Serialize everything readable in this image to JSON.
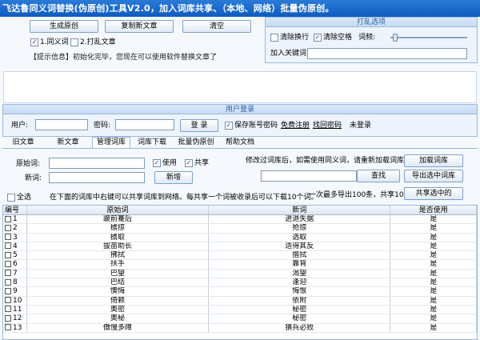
{
  "title": "飞达鲁同义词替换(伪原创)工具V2.0，加入词库共享、（本地、网络）批量伪原创。",
  "top": {
    "generate_btn": "生成原创",
    "copy_btn": "复制新文章",
    "clear_btn": "清空",
    "cb_synonym": "1.同义词",
    "cb_shuffle": "2.打乱文章",
    "notice": "【提示信息】初始化完毕，您现在可以使用软件替换文章了"
  },
  "shuffle": {
    "title": "打乱选项",
    "cb_clear_newline": "清除换行",
    "cb_clear_space": "清除空格",
    "frequency_label": "词频:",
    "frequency_value": 0.05,
    "keyword_label": "加入关键词"
  },
  "login": {
    "title": "用户登录",
    "user_label": "用户:",
    "password_label": "密码:",
    "login_btn": "登 录",
    "save_password": "保存账号密码",
    "register_link": "免费注册",
    "recover_link": "找回密码",
    "status": "未登录"
  },
  "tabs": [
    "旧文章",
    "新文章",
    "管理词库",
    "词库下载",
    "批量伪原创",
    "帮助文档"
  ],
  "active_tab": 2,
  "manage": {
    "orig_label": "原始词:",
    "new_label": "新词:",
    "cb_use": "使用",
    "cb_share": "共享",
    "add_btn": "新增",
    "modify_hint": "修改过词库后，如需使用同义词，请重新加载词库：",
    "load_btn": "加载词库",
    "search_btn": "查找",
    "export_btn": "导出选中词库",
    "share_btn": "共享选中的",
    "select_all": "全选",
    "share_hint": "在下面的词库中右键可以共享词库到网络。每共享一个词被收录后可以下载10个词。",
    "export_hint": "一次最多导出100条，共享10条。"
  },
  "grid": {
    "columns": [
      "编号",
      "原始词",
      "新词",
      "是否使用"
    ],
    "rows": [
      {
        "num": "1",
        "orig": "跛前蹇后",
        "new": "进退失据",
        "use": "是"
      },
      {
        "num": "2",
        "orig": "掳掠",
        "new": "抢掠",
        "use": "是"
      },
      {
        "num": "3",
        "orig": "掳取",
        "new": "选取",
        "use": "是"
      },
      {
        "num": "4",
        "orig": "拔苗助长",
        "new": "适得其反",
        "use": "是"
      },
      {
        "num": "5",
        "orig": "拂拭",
        "new": "揩拭",
        "use": "是"
      },
      {
        "num": "6",
        "orig": "扶手",
        "new": "靠背",
        "use": "是"
      },
      {
        "num": "7",
        "orig": "巴望",
        "new": "渴望",
        "use": "是"
      },
      {
        "num": "8",
        "orig": "巴结",
        "new": "逢迎",
        "use": "是"
      },
      {
        "num": "9",
        "orig": "懊悔",
        "new": "悔恨",
        "use": "是"
      },
      {
        "num": "10",
        "orig": "倚赖",
        "new": "依附",
        "use": "是"
      },
      {
        "num": "11",
        "orig": "奥密",
        "new": "秘密",
        "use": "是"
      },
      {
        "num": "12",
        "orig": "奥秘",
        "new": "秘密",
        "use": "是"
      },
      {
        "num": "13",
        "orig": "傲慢多障",
        "new": "猜兵必败",
        "use": "是"
      }
    ]
  }
}
